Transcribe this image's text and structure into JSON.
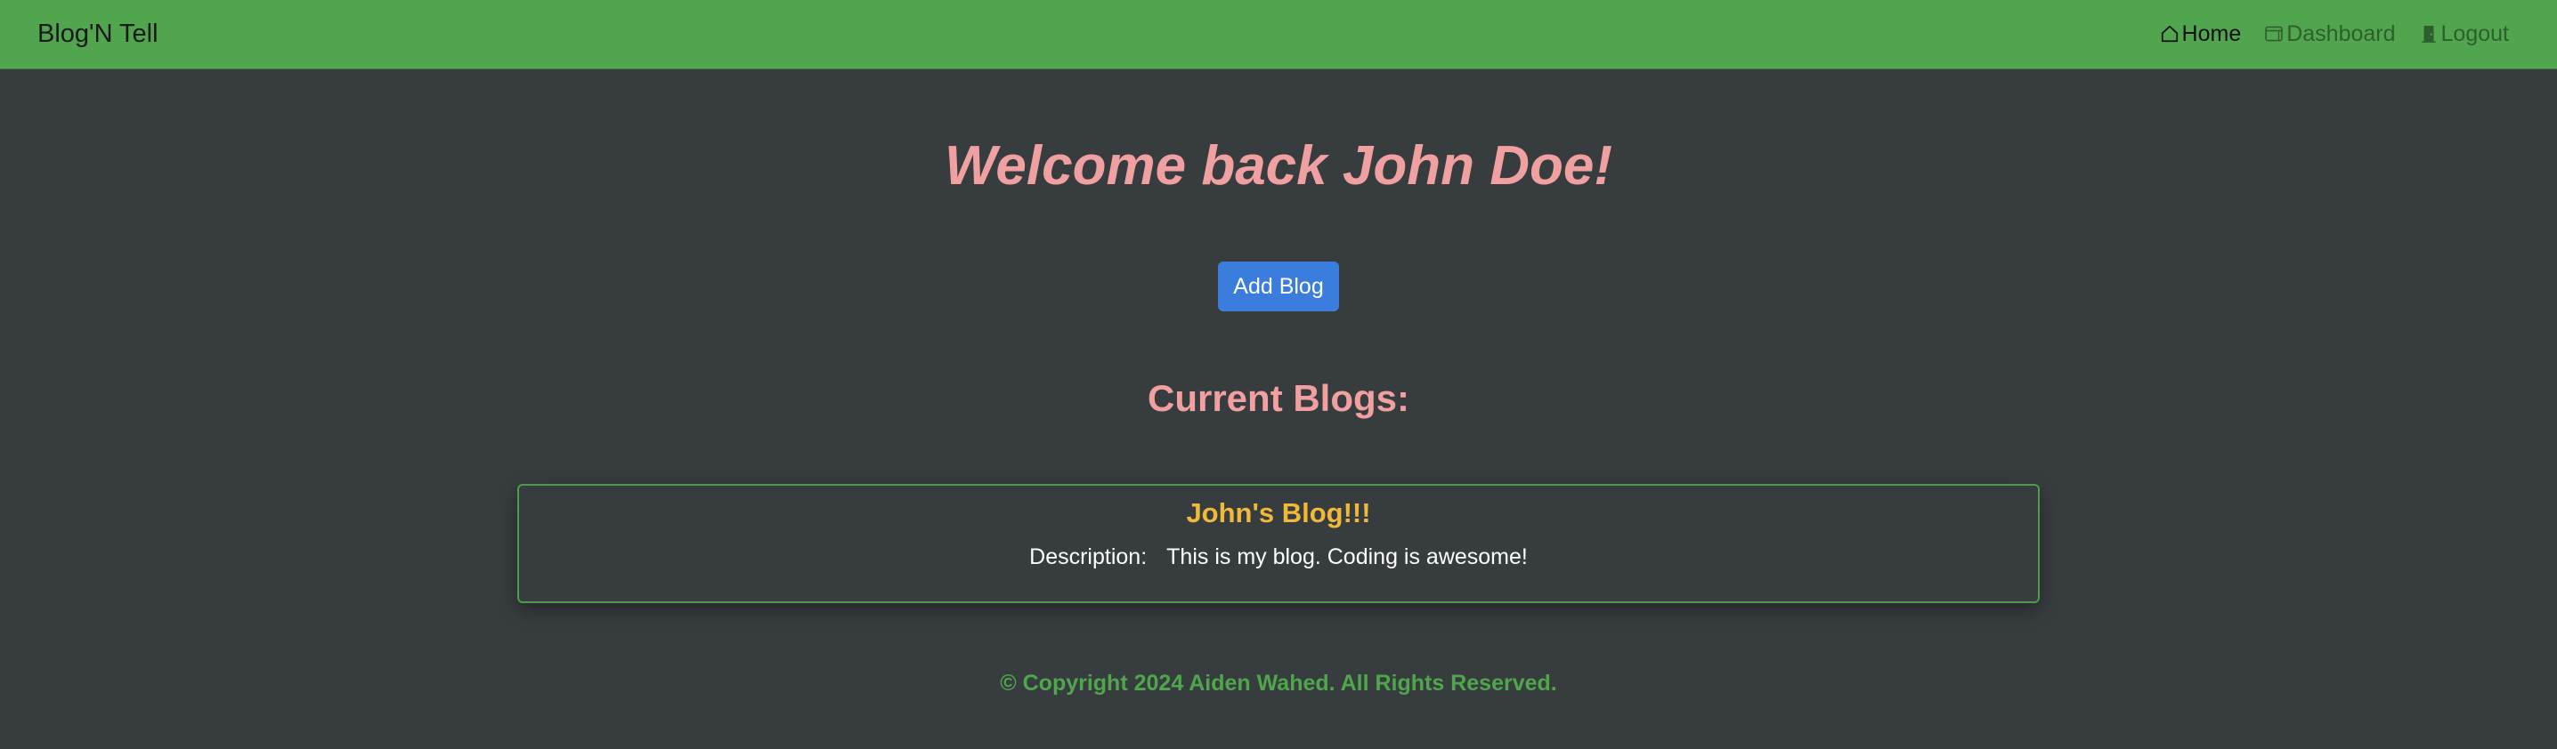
{
  "navbar": {
    "brand": "Blog'N Tell",
    "links": [
      {
        "label": "Home",
        "icon": "home-icon",
        "active": true
      },
      {
        "label": "Dashboard",
        "icon": "dashboard-icon",
        "active": false
      },
      {
        "label": "Logout",
        "icon": "door-icon",
        "active": false
      }
    ]
  },
  "main": {
    "welcome": "Welcome back John Doe!",
    "add_button": "Add Blog",
    "current_heading": "Current Blogs:",
    "blogs": [
      {
        "title": "John's Blog!!!",
        "description_label": "Description:",
        "description": "This is my blog. Coding is awesome!"
      }
    ]
  },
  "footer": {
    "text": "© Copyright 2024 Aiden Wahed. All Rights Reserved."
  },
  "colors": {
    "navbar": "#51a54f",
    "background": "#373c3e",
    "heading_pink": "#f0a0a0",
    "blog_title": "#f0b93a",
    "button_blue": "#3b7ddd",
    "footer_green": "#4fa64c"
  }
}
